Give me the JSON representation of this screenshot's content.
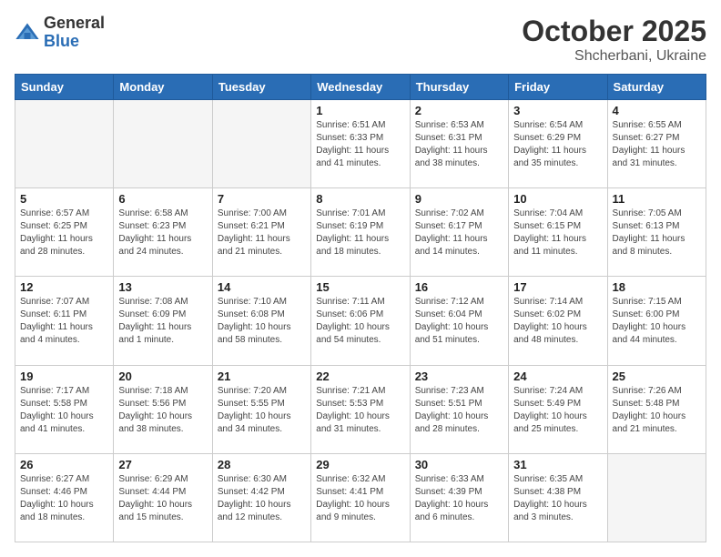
{
  "header": {
    "logo_general": "General",
    "logo_blue": "Blue",
    "month": "October 2025",
    "location": "Shcherbani, Ukraine"
  },
  "weekdays": [
    "Sunday",
    "Monday",
    "Tuesday",
    "Wednesday",
    "Thursday",
    "Friday",
    "Saturday"
  ],
  "weeks": [
    [
      {
        "day": "",
        "info": ""
      },
      {
        "day": "",
        "info": ""
      },
      {
        "day": "",
        "info": ""
      },
      {
        "day": "1",
        "info": "Sunrise: 6:51 AM\nSunset: 6:33 PM\nDaylight: 11 hours\nand 41 minutes."
      },
      {
        "day": "2",
        "info": "Sunrise: 6:53 AM\nSunset: 6:31 PM\nDaylight: 11 hours\nand 38 minutes."
      },
      {
        "day": "3",
        "info": "Sunrise: 6:54 AM\nSunset: 6:29 PM\nDaylight: 11 hours\nand 35 minutes."
      },
      {
        "day": "4",
        "info": "Sunrise: 6:55 AM\nSunset: 6:27 PM\nDaylight: 11 hours\nand 31 minutes."
      }
    ],
    [
      {
        "day": "5",
        "info": "Sunrise: 6:57 AM\nSunset: 6:25 PM\nDaylight: 11 hours\nand 28 minutes."
      },
      {
        "day": "6",
        "info": "Sunrise: 6:58 AM\nSunset: 6:23 PM\nDaylight: 11 hours\nand 24 minutes."
      },
      {
        "day": "7",
        "info": "Sunrise: 7:00 AM\nSunset: 6:21 PM\nDaylight: 11 hours\nand 21 minutes."
      },
      {
        "day": "8",
        "info": "Sunrise: 7:01 AM\nSunset: 6:19 PM\nDaylight: 11 hours\nand 18 minutes."
      },
      {
        "day": "9",
        "info": "Sunrise: 7:02 AM\nSunset: 6:17 PM\nDaylight: 11 hours\nand 14 minutes."
      },
      {
        "day": "10",
        "info": "Sunrise: 7:04 AM\nSunset: 6:15 PM\nDaylight: 11 hours\nand 11 minutes."
      },
      {
        "day": "11",
        "info": "Sunrise: 7:05 AM\nSunset: 6:13 PM\nDaylight: 11 hours\nand 8 minutes."
      }
    ],
    [
      {
        "day": "12",
        "info": "Sunrise: 7:07 AM\nSunset: 6:11 PM\nDaylight: 11 hours\nand 4 minutes."
      },
      {
        "day": "13",
        "info": "Sunrise: 7:08 AM\nSunset: 6:09 PM\nDaylight: 11 hours\nand 1 minute."
      },
      {
        "day": "14",
        "info": "Sunrise: 7:10 AM\nSunset: 6:08 PM\nDaylight: 10 hours\nand 58 minutes."
      },
      {
        "day": "15",
        "info": "Sunrise: 7:11 AM\nSunset: 6:06 PM\nDaylight: 10 hours\nand 54 minutes."
      },
      {
        "day": "16",
        "info": "Sunrise: 7:12 AM\nSunset: 6:04 PM\nDaylight: 10 hours\nand 51 minutes."
      },
      {
        "day": "17",
        "info": "Sunrise: 7:14 AM\nSunset: 6:02 PM\nDaylight: 10 hours\nand 48 minutes."
      },
      {
        "day": "18",
        "info": "Sunrise: 7:15 AM\nSunset: 6:00 PM\nDaylight: 10 hours\nand 44 minutes."
      }
    ],
    [
      {
        "day": "19",
        "info": "Sunrise: 7:17 AM\nSunset: 5:58 PM\nDaylight: 10 hours\nand 41 minutes."
      },
      {
        "day": "20",
        "info": "Sunrise: 7:18 AM\nSunset: 5:56 PM\nDaylight: 10 hours\nand 38 minutes."
      },
      {
        "day": "21",
        "info": "Sunrise: 7:20 AM\nSunset: 5:55 PM\nDaylight: 10 hours\nand 34 minutes."
      },
      {
        "day": "22",
        "info": "Sunrise: 7:21 AM\nSunset: 5:53 PM\nDaylight: 10 hours\nand 31 minutes."
      },
      {
        "day": "23",
        "info": "Sunrise: 7:23 AM\nSunset: 5:51 PM\nDaylight: 10 hours\nand 28 minutes."
      },
      {
        "day": "24",
        "info": "Sunrise: 7:24 AM\nSunset: 5:49 PM\nDaylight: 10 hours\nand 25 minutes."
      },
      {
        "day": "25",
        "info": "Sunrise: 7:26 AM\nSunset: 5:48 PM\nDaylight: 10 hours\nand 21 minutes."
      }
    ],
    [
      {
        "day": "26",
        "info": "Sunrise: 6:27 AM\nSunset: 4:46 PM\nDaylight: 10 hours\nand 18 minutes."
      },
      {
        "day": "27",
        "info": "Sunrise: 6:29 AM\nSunset: 4:44 PM\nDaylight: 10 hours\nand 15 minutes."
      },
      {
        "day": "28",
        "info": "Sunrise: 6:30 AM\nSunset: 4:42 PM\nDaylight: 10 hours\nand 12 minutes."
      },
      {
        "day": "29",
        "info": "Sunrise: 6:32 AM\nSunset: 4:41 PM\nDaylight: 10 hours\nand 9 minutes."
      },
      {
        "day": "30",
        "info": "Sunrise: 6:33 AM\nSunset: 4:39 PM\nDaylight: 10 hours\nand 6 minutes."
      },
      {
        "day": "31",
        "info": "Sunrise: 6:35 AM\nSunset: 4:38 PM\nDaylight: 10 hours\nand 3 minutes."
      },
      {
        "day": "",
        "info": ""
      }
    ]
  ]
}
